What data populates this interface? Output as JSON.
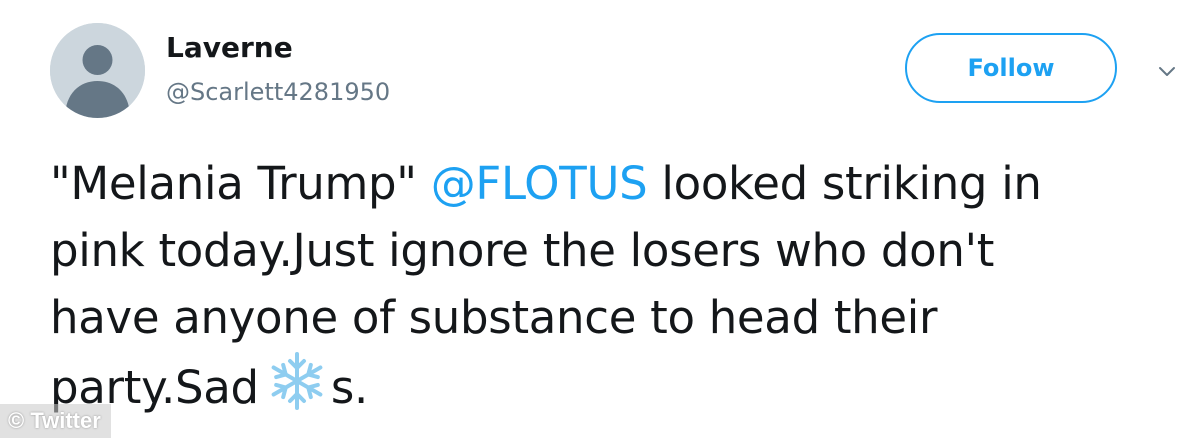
{
  "user": {
    "display_name": "Laverne",
    "handle": "@Scarlett4281950",
    "avatar_icon": "default-profile-icon"
  },
  "actions": {
    "follow_label": "Follow",
    "menu_icon": "chevron-down-icon"
  },
  "tweet": {
    "line1_a": "\"Melania Trump\" ",
    "mention": "@FLOTUS",
    "line1_b": " looked striking in",
    "line2": "pink today.Just ignore the losers who don't",
    "line3": "have anyone of substance to head their",
    "line4_a": "party.Sad",
    "emoji_icon": "snowflake-icon",
    "line4_b": "s."
  },
  "watermark": {
    "text": "© Twitter"
  },
  "colors": {
    "accent": "#1da1f2",
    "text": "#14171a",
    "secondary": "#657786",
    "avatar_bg": "#ccd6dd",
    "avatar_fg": "#657786",
    "snowflake": "#8ecdf0"
  }
}
